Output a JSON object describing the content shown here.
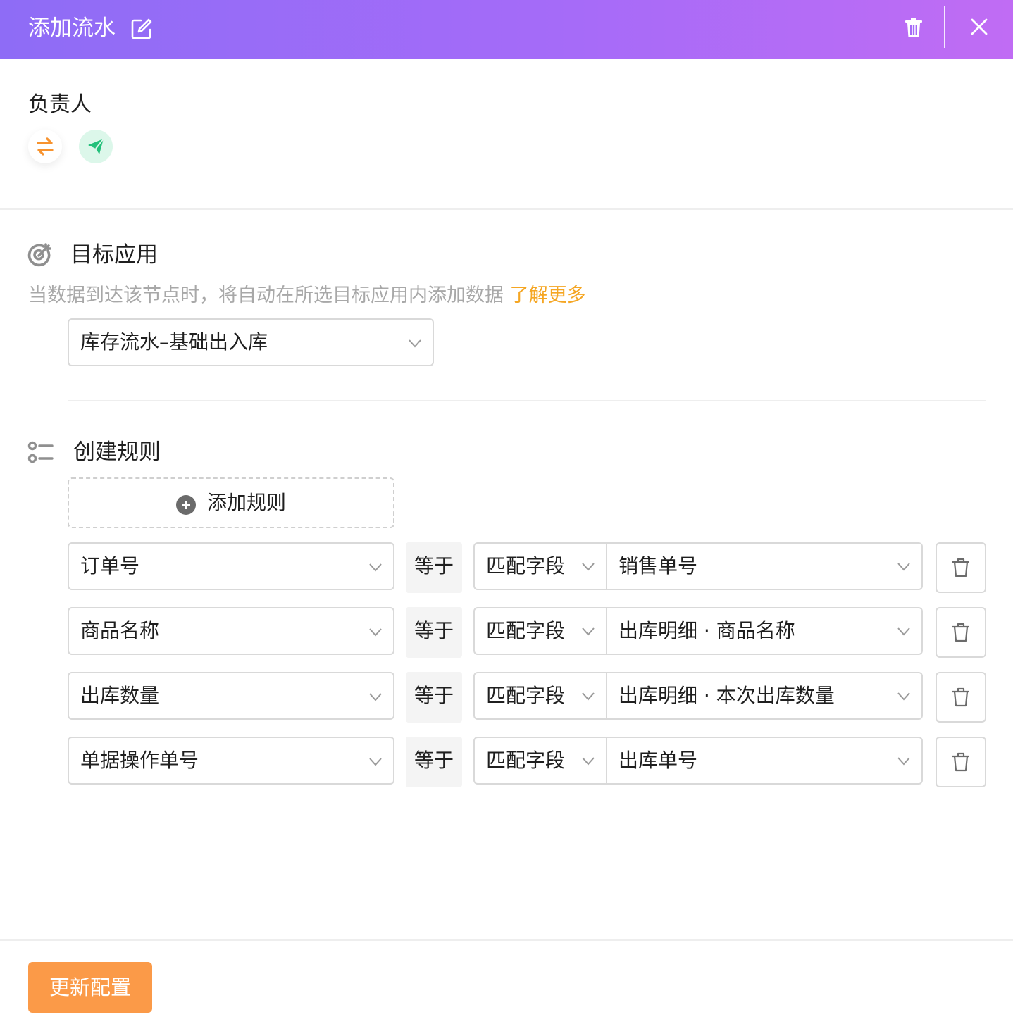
{
  "header": {
    "title": "添加流水",
    "accent_start": "#8e6cf6",
    "accent_end": "#c06cf4"
  },
  "owner": {
    "label": "负责人",
    "avatars": [
      {
        "icon": "swap-arrows-icon",
        "color": "#f7932f"
      },
      {
        "icon": "paper-plane-icon",
        "color": "#22c07a"
      }
    ]
  },
  "target_app": {
    "title": "目标应用",
    "description": "当数据到达该节点时，将自动在所选目标应用内添加数据",
    "learn_more": "了解更多",
    "selected": "库存流水–基础出入库"
  },
  "rules": {
    "title": "创建规则",
    "add_label": "添加规则",
    "items": [
      {
        "field": "订单号",
        "operator": "等于",
        "match_type": "匹配字段",
        "value": "销售单号"
      },
      {
        "field": "商品名称",
        "operator": "等于",
        "match_type": "匹配字段",
        "value": "出库明细 · 商品名称"
      },
      {
        "field": "出库数量",
        "operator": "等于",
        "match_type": "匹配字段",
        "value": "出库明细 · 本次出库数量"
      },
      {
        "field": "单据操作单号",
        "operator": "等于",
        "match_type": "匹配字段",
        "value": "出库单号"
      }
    ]
  },
  "footer": {
    "submit_label": "更新配置",
    "submit_color": "#fb9a48"
  }
}
